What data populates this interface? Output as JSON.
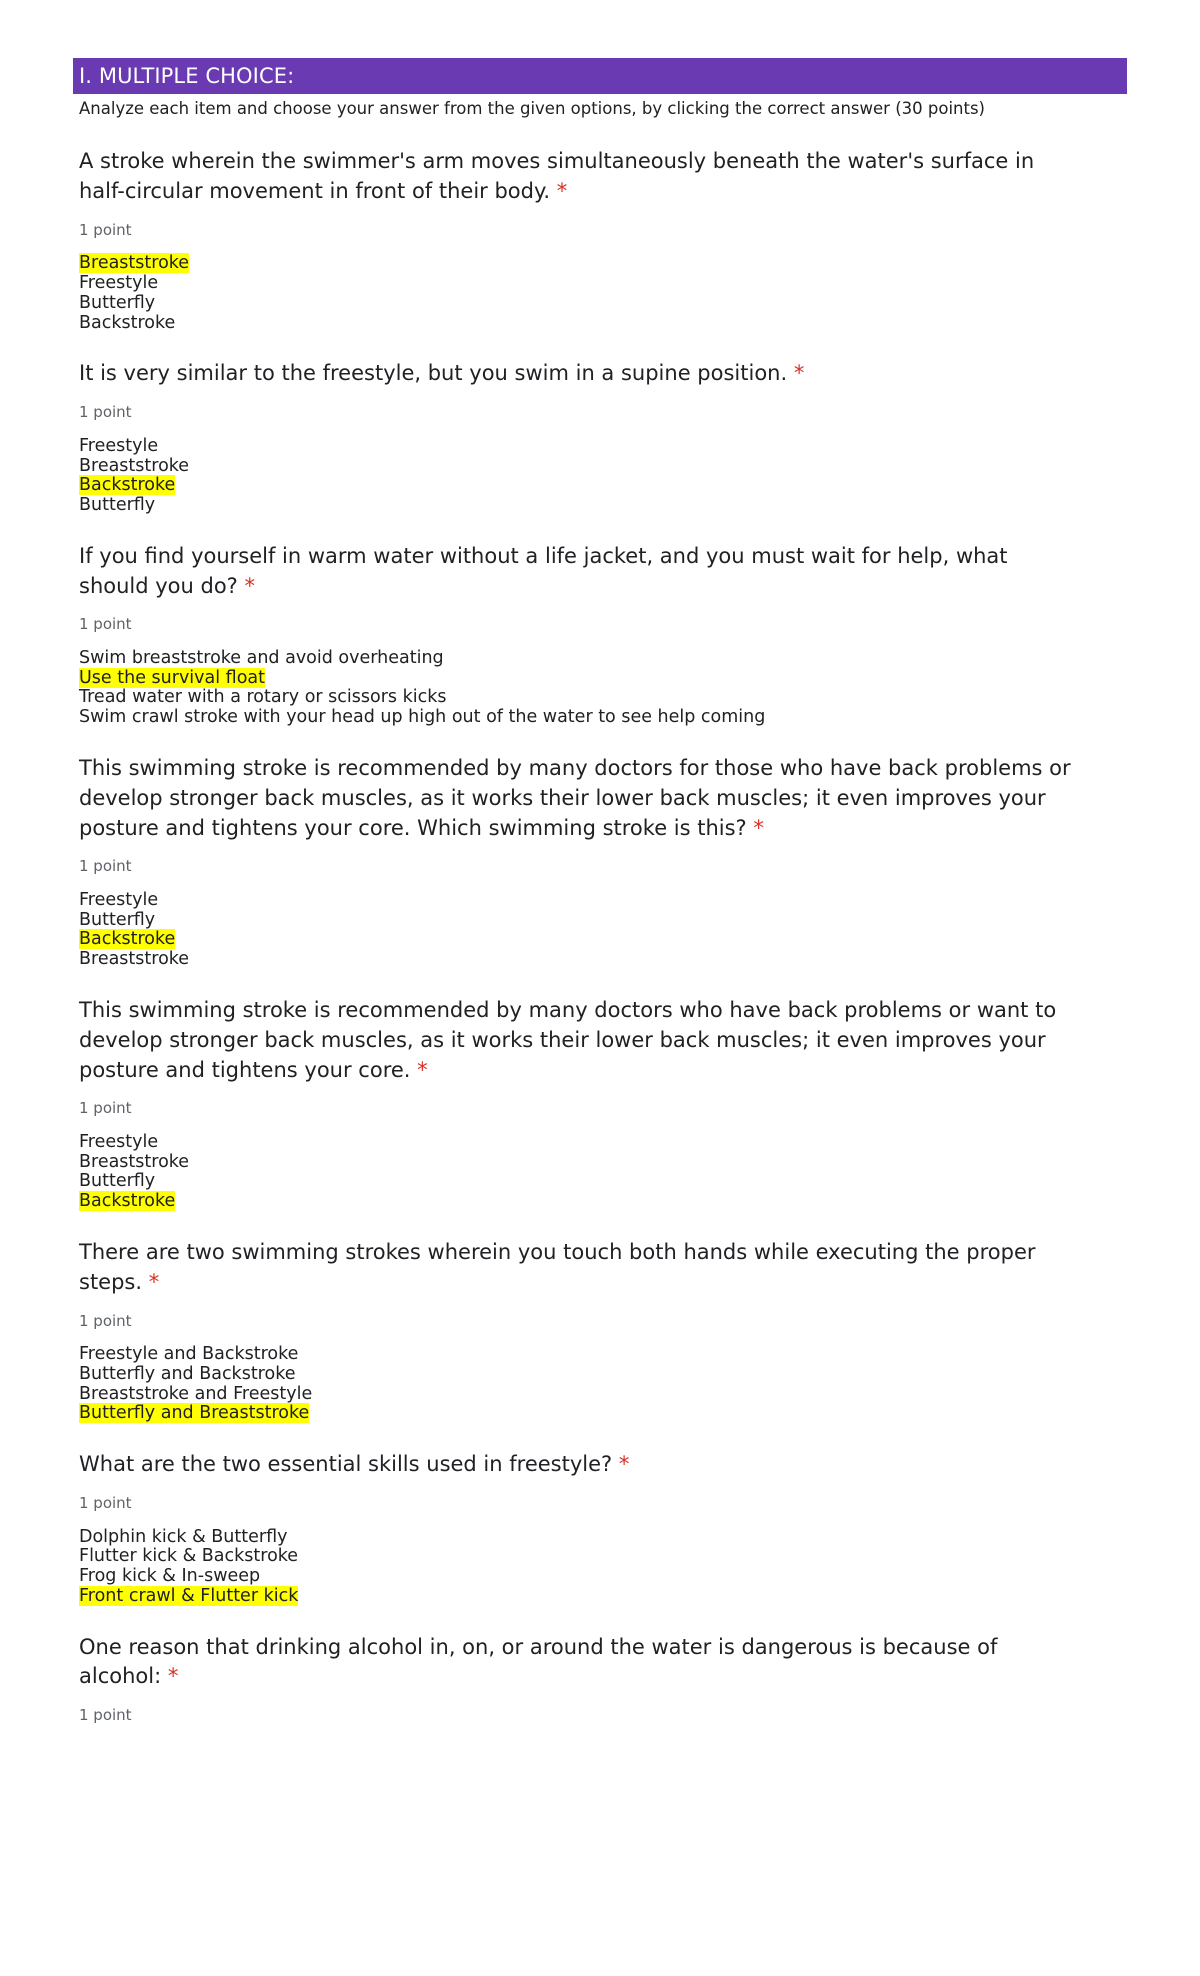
{
  "section": {
    "banner_title": "I. MULTIPLE CHOICE:",
    "subtitle": "Analyze each item and choose your answer from the given options, by clicking the correct answer (30 points)",
    "banner_color": "#6a3ab2",
    "banner_text_color": "#ffffff",
    "highlight_color": "#ffff00",
    "required_marker": "*",
    "required_marker_color": "#d93025"
  },
  "questions": [
    {
      "text": "A stroke wherein the swimmer's arm moves simultaneously beneath the water's surface in half-circular movement in front of their body.",
      "required": "*",
      "points": "1 point",
      "options": [
        {
          "label": "Breaststroke",
          "highlighted": true
        },
        {
          "label": "Freestyle",
          "highlighted": false
        },
        {
          "label": "Butterfly",
          "highlighted": false
        },
        {
          "label": "Backstroke",
          "highlighted": false
        }
      ]
    },
    {
      "text": "It is very similar to the freestyle, but you swim in a supine position.",
      "required": "*",
      "points": "1 point",
      "options": [
        {
          "label": "Freestyle",
          "highlighted": false
        },
        {
          "label": "Breaststroke",
          "highlighted": false
        },
        {
          "label": "Backstroke",
          "highlighted": true
        },
        {
          "label": "Butterfly",
          "highlighted": false
        }
      ]
    },
    {
      "text": "If you find yourself in warm water without a life jacket, and you must wait for help, what should you do?",
      "required": "*",
      "points": "1 point",
      "options": [
        {
          "label": "Swim breaststroke and avoid overheating",
          "highlighted": false
        },
        {
          "label": "Use the survival float",
          "highlighted": true
        },
        {
          "label": "Tread water with a rotary or scissors kicks",
          "highlighted": false
        },
        {
          "label": "Swim crawl stroke with your head up high out of the water to see help coming",
          "highlighted": false
        }
      ]
    },
    {
      "text": "This swimming stroke is recommended by many doctors for those who have back problems or develop stronger back muscles, as it works their lower back muscles; it even improves your posture and tightens your core. Which swimming stroke is this?",
      "required": "*",
      "points": "1 point",
      "options": [
        {
          "label": "Freestyle",
          "highlighted": false
        },
        {
          "label": "Butterfly",
          "highlighted": false
        },
        {
          "label": "Backstroke",
          "highlighted": true
        },
        {
          "label": "Breaststroke",
          "highlighted": false
        }
      ]
    },
    {
      "text": "This swimming stroke is recommended by many doctors who have back problems or want to develop stronger back muscles, as it works their lower back muscles; it even improves your posture and tightens your core.",
      "required": "*",
      "points": "1 point",
      "options": [
        {
          "label": "Freestyle",
          "highlighted": false
        },
        {
          "label": "Breaststroke",
          "highlighted": false
        },
        {
          "label": "Butterfly",
          "highlighted": false
        },
        {
          "label": "Backstroke",
          "highlighted": true
        }
      ]
    },
    {
      "text": "There are two swimming strokes wherein you touch both hands while executing the proper steps.",
      "required": "*",
      "points": "1 point",
      "options": [
        {
          "label": "Freestyle and Backstroke",
          "highlighted": false
        },
        {
          "label": "Butterfly and Backstroke",
          "highlighted": false
        },
        {
          "label": "Breaststroke and Freestyle",
          "highlighted": false
        },
        {
          "label": "Butterfly and Breaststroke",
          "highlighted": true
        }
      ]
    },
    {
      "text": "What are the two essential skills used in freestyle?",
      "required": "*",
      "points": "1 point",
      "options": [
        {
          "label": "Dolphin kick & Butterfly",
          "highlighted": false
        },
        {
          "label": "Flutter kick & Backstroke",
          "highlighted": false
        },
        {
          "label": "Frog kick & In-sweep",
          "highlighted": false
        },
        {
          "label": "Front crawl & Flutter kick",
          "highlighted": true
        }
      ]
    },
    {
      "text": "One reason that drinking alcohol in, on, or around the water is dangerous is because of alcohol:",
      "required": "*",
      "points": "1 point",
      "options": []
    }
  ]
}
